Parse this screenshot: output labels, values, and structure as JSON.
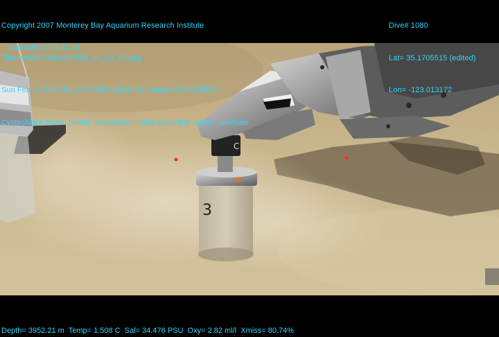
{
  "overlay": {
    "copyright": "Copyright 2007 Monterey Bay Aquarium Research Institute",
    "file_path": "Tiburon/2007/tibr1080/03_24_12_28.png",
    "datetime": "Sun Feb  4 19:40:51 2007 GMT (local +8)  esecs=1170618051",
    "annotation": "Cystechinus loveni (linda): observation notes decorator urchin, alternate",
    "timecode": "timecode 02:51:41:18",
    "dive": "Dive# 1080",
    "lat": "Lat= 35.1705515 (edited)",
    "lon": "Lon= -123.013172",
    "telemetry": "Depth= 3952.21 m  Temp= 1.508 C  Sal= 34.476 PSU  Oxy= 2.82 ml/l  Xmiss= 80.74%"
  },
  "colors": {
    "overlay_text": "#2fd7ff",
    "seafloor": "#c8b48a",
    "laser": "#ff2a10"
  },
  "scene": {
    "objects": [
      "robotic-arm",
      "sample-jar",
      "sediment-cloud",
      "sampler-cylinder",
      "laser-dots"
    ],
    "jar_label": "3"
  }
}
